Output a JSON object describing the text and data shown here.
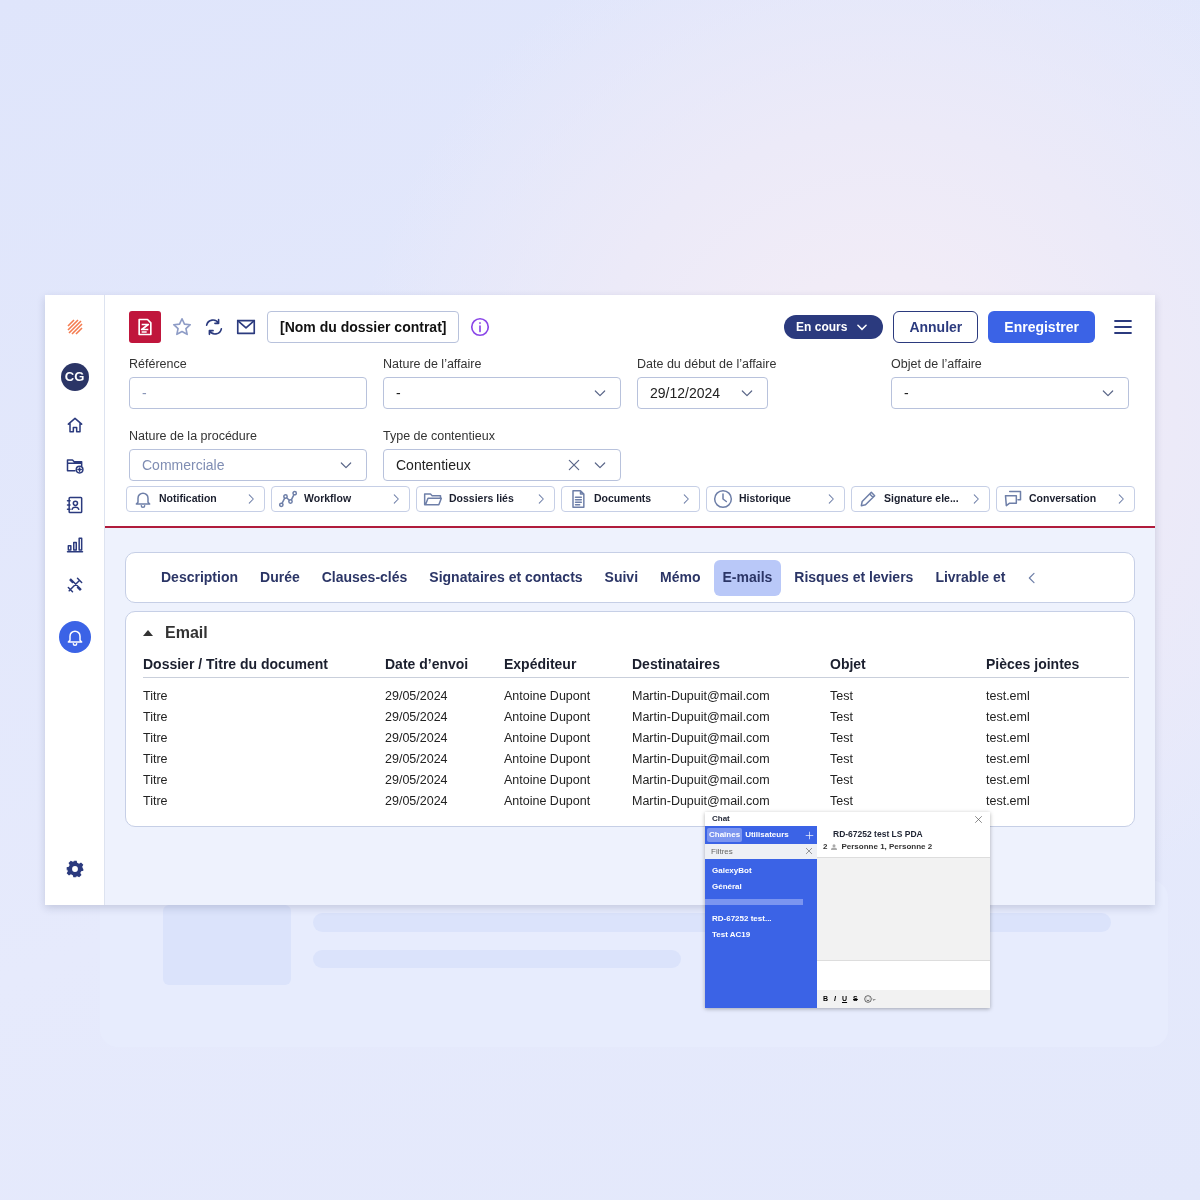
{
  "sidebar": {
    "avatar": "CG",
    "items": [
      {
        "kind": "home",
        "selected": false
      },
      {
        "kind": "folder-add",
        "selected": false
      },
      {
        "kind": "contacts",
        "selected": false
      },
      {
        "kind": "chart",
        "selected": false
      },
      {
        "kind": "tools",
        "selected": false
      },
      {
        "kind": "bell",
        "selected": true
      }
    ],
    "bottom": {
      "kind": "gear",
      "selected": false
    }
  },
  "header": {
    "title": "[Nom du dossier contrat]",
    "favorite": false,
    "status": "En cours",
    "buttons": [
      {
        "label": "Annuler",
        "kind": "secondary"
      },
      {
        "label": "Enregistrer",
        "kind": "primary"
      }
    ]
  },
  "fields": [
    {
      "label": "Référence",
      "kind": "text",
      "placeholder": "-"
    },
    {
      "label": "Nature de l’affaire",
      "kind": "select",
      "value": "-"
    },
    {
      "label": "Date du début de l’affaire",
      "kind": "date",
      "value": "29/12/2024"
    },
    {
      "label": "Objet de l’affaire",
      "kind": "select",
      "value": "-"
    },
    {
      "label": "Nature de la procédure",
      "kind": "select",
      "placeholder": "Commerciale"
    },
    {
      "label": "Type de contentieux",
      "kind": "select",
      "value": "Contentieux",
      "clearable": true
    }
  ],
  "shortcuts": [
    {
      "label": "Notification",
      "kind": "bell"
    },
    {
      "label": "Workflow",
      "kind": "workflow"
    },
    {
      "label": "Dossiers liés",
      "kind": "folder"
    },
    {
      "label": "Documents",
      "kind": "document"
    },
    {
      "label": "Historique",
      "kind": "clock"
    },
    {
      "label": "Signature ele...",
      "kind": "pen"
    },
    {
      "label": "Conversation",
      "kind": "chat"
    }
  ],
  "tabs": [
    {
      "label": "Description",
      "selected": false
    },
    {
      "label": "Durée",
      "selected": false
    },
    {
      "label": "Clauses-clés",
      "selected": false
    },
    {
      "label": "Signataires et contacts",
      "selected": false
    },
    {
      "label": "Suivi",
      "selected": false
    },
    {
      "label": "Mémo",
      "selected": false
    },
    {
      "label": "E-mails",
      "selected": true
    },
    {
      "label": "Risques et leviers",
      "selected": false
    },
    {
      "label": "Livrable et",
      "selected": false
    }
  ],
  "email_section": {
    "title": "Email",
    "expanded": true,
    "columns": [
      "Dossier / Titre du document",
      "Date d’envoi",
      "Expéditeur",
      "Destinataires",
      "Objet",
      "Pièces jointes"
    ],
    "rows": [
      [
        "Titre",
        "29/05/2024",
        "Antoine Dupont",
        "Martin-Dupuit@mail.com",
        "Test",
        "test.eml"
      ],
      [
        "Titre",
        "29/05/2024",
        "Antoine Dupont",
        "Martin-Dupuit@mail.com",
        "Test",
        "test.eml"
      ],
      [
        "Titre",
        "29/05/2024",
        "Antoine Dupont",
        "Martin-Dupuit@mail.com",
        "Test",
        "test.eml"
      ],
      [
        "Titre",
        "29/05/2024",
        "Antoine Dupont",
        "Martin-Dupuit@mail.com",
        "Test",
        "test.eml"
      ],
      [
        "Titre",
        "29/05/2024",
        "Antoine Dupont",
        "Martin-Dupuit@mail.com",
        "Test",
        "test.eml"
      ],
      [
        "Titre",
        "29/05/2024",
        "Antoine Dupont",
        "Martin-Dupuit@mail.com",
        "Test",
        "test.eml"
      ]
    ]
  },
  "chat": {
    "title": "Chat",
    "tabs": [
      {
        "label": "Chaînes",
        "selected": true
      },
      {
        "label": "Utilisateurs",
        "selected": false
      }
    ],
    "filter_placeholder": "Filtres",
    "channel_groups": [
      [
        "GalexyBot",
        "Général"
      ],
      [
        "RD-67252 test...",
        "Test AC19"
      ]
    ],
    "conversation": {
      "title": "RD-67252 test LS PDA",
      "member_count": "2",
      "members": "Personne 1, Personne 2"
    },
    "toolbar": [
      "B",
      "I",
      "U",
      "S"
    ]
  }
}
